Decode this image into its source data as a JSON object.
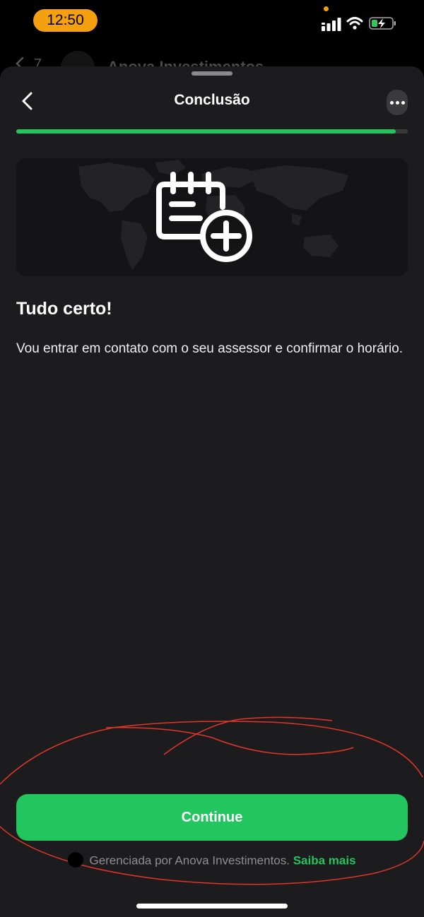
{
  "status_bar": {
    "time": "12:50"
  },
  "behind_screen": {
    "count": "7",
    "title": "Anova Investimentos"
  },
  "header": {
    "title": "Conclusão"
  },
  "progress": {
    "fraction": 0.97
  },
  "content": {
    "heading": "Tudo certo!",
    "body": "Vou entrar em contato com o seu assessor e confirmar o horário."
  },
  "actions": {
    "continue_label": "Continue"
  },
  "footer": {
    "text": "Gerenciada por Anova Investimentos.",
    "link": "Saiba mais"
  },
  "colors": {
    "accent": "#22c55e",
    "sheet": "#1c1c1e",
    "time_pill": "#f5a00e",
    "annotation": "#e0362a"
  },
  "icons": [
    "chevron-left-icon",
    "more-horizontal-icon",
    "notepad-plus-icon",
    "world-map",
    "signal-icon",
    "wifi-icon",
    "battery-charging-icon"
  ]
}
